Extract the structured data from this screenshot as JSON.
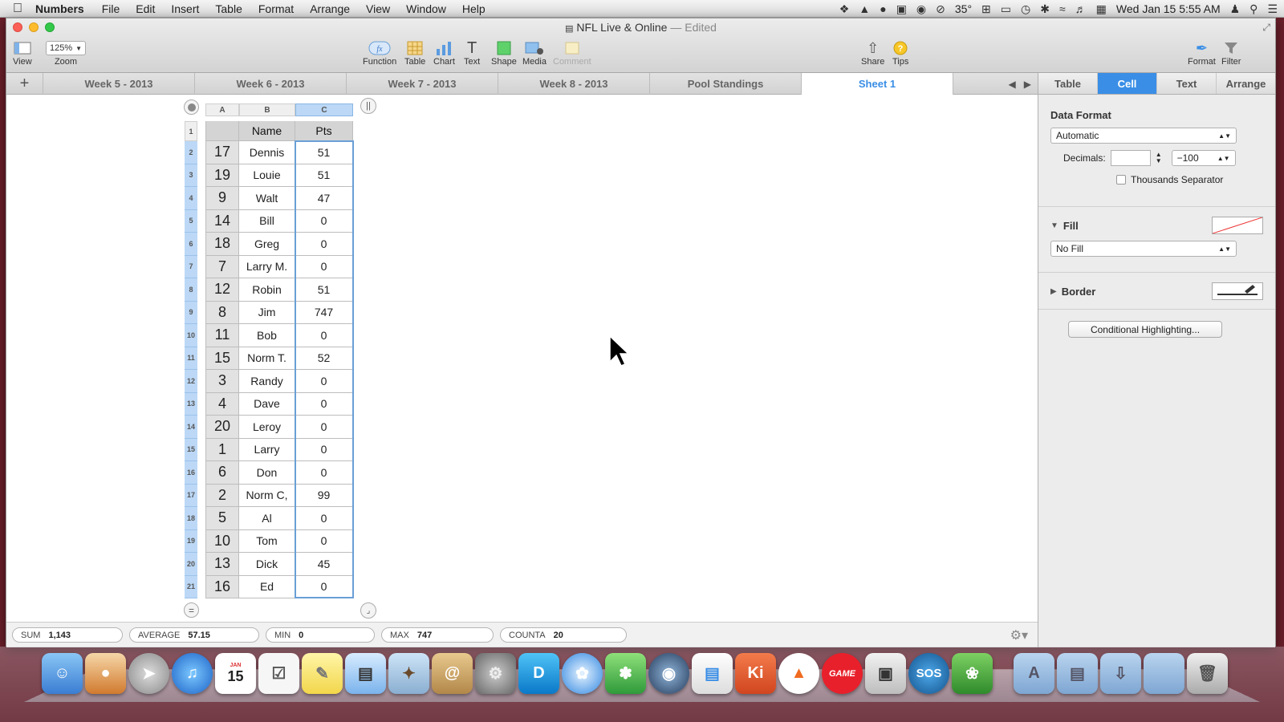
{
  "menubar": {
    "app_name": "Numbers",
    "items": [
      "File",
      "Edit",
      "Insert",
      "Table",
      "Format",
      "Arrange",
      "View",
      "Window",
      "Help"
    ],
    "temperature": "35°",
    "datetime": "Wed Jan 15  5:55 AM"
  },
  "window": {
    "doc_title": "NFL Live & Online",
    "edited_label": "— Edited"
  },
  "toolbar": {
    "view_label": "View",
    "zoom_value": "125%",
    "zoom_label": "Zoom",
    "function_label": "Function",
    "table_label": "Table",
    "chart_label": "Chart",
    "text_label": "Text",
    "shape_label": "Shape",
    "media_label": "Media",
    "comment_label": "Comment",
    "share_label": "Share",
    "tips_label": "Tips",
    "format_label": "Format",
    "filter_label": "Filter"
  },
  "sheets": [
    "Week 5 - 2013",
    "Week 6 - 2013",
    "Week 7 - 2013",
    "Week 8 - 2013",
    "Pool Standings",
    "Sheet 1"
  ],
  "active_sheet": "Sheet 1",
  "table": {
    "col_letters": [
      "A",
      "B",
      "C"
    ],
    "header": {
      "a": "",
      "b": "Name",
      "c": "Pts"
    },
    "rows": [
      {
        "num": "2",
        "a": "17",
        "b": "Dennis",
        "c": "51"
      },
      {
        "num": "3",
        "a": "19",
        "b": "Louie",
        "c": "51"
      },
      {
        "num": "4",
        "a": "9",
        "b": "Walt",
        "c": "47"
      },
      {
        "num": "5",
        "a": "14",
        "b": "Bill",
        "c": "0"
      },
      {
        "num": "6",
        "a": "18",
        "b": "Greg",
        "c": "0"
      },
      {
        "num": "7",
        "a": "7",
        "b": "Larry M.",
        "c": "0"
      },
      {
        "num": "8",
        "a": "12",
        "b": "Robin",
        "c": "51"
      },
      {
        "num": "9",
        "a": "8",
        "b": "Jim",
        "c": "747"
      },
      {
        "num": "10",
        "a": "11",
        "b": "Bob",
        "c": "0"
      },
      {
        "num": "11",
        "a": "15",
        "b": "Norm T.",
        "c": "52"
      },
      {
        "num": "12",
        "a": "3",
        "b": "Randy",
        "c": "0"
      },
      {
        "num": "13",
        "a": "4",
        "b": "Dave",
        "c": "0"
      },
      {
        "num": "14",
        "a": "20",
        "b": "Leroy",
        "c": "0"
      },
      {
        "num": "15",
        "a": "1",
        "b": "Larry",
        "c": "0"
      },
      {
        "num": "16",
        "a": "6",
        "b": "Don",
        "c": "0"
      },
      {
        "num": "17",
        "a": "2",
        "b": "Norm C,",
        "c": "99"
      },
      {
        "num": "18",
        "a": "5",
        "b": "Al",
        "c": "0"
      },
      {
        "num": "19",
        "a": "10",
        "b": "Tom",
        "c": "0"
      },
      {
        "num": "20",
        "a": "13",
        "b": "Dick",
        "c": "45"
      },
      {
        "num": "21",
        "a": "16",
        "b": "Ed",
        "c": "0"
      }
    ],
    "header_row_num": "1"
  },
  "status": {
    "sum_label": "SUM",
    "sum": "1,143",
    "avg_label": "AVERAGE",
    "avg": "57.15",
    "min_label": "MIN",
    "min": "0",
    "max_label": "MAX",
    "max": "747",
    "counta_label": "COUNTA",
    "counta": "20"
  },
  "panel": {
    "tabs": [
      "Table",
      "Cell",
      "Text",
      "Arrange"
    ],
    "active_tab": "Cell",
    "data_format_label": "Data Format",
    "data_format_value": "Automatic",
    "decimals_label": "Decimals:",
    "decimals_value": "",
    "negative_value": "−100",
    "thousands_label": "Thousands Separator",
    "fill_label": "Fill",
    "fill_value": "No Fill",
    "border_label": "Border",
    "conditional_button": "Conditional Highlighting..."
  },
  "dock": {
    "game_label": "GAME",
    "sos_label": "SOS",
    "ki_label": "Ki",
    "calendar_day": "15",
    "calendar_month": "JAN"
  },
  "colors": {
    "accent": "#3a8ee6",
    "selection": "#bcd8f6",
    "desktop": "#6a1f2a"
  }
}
